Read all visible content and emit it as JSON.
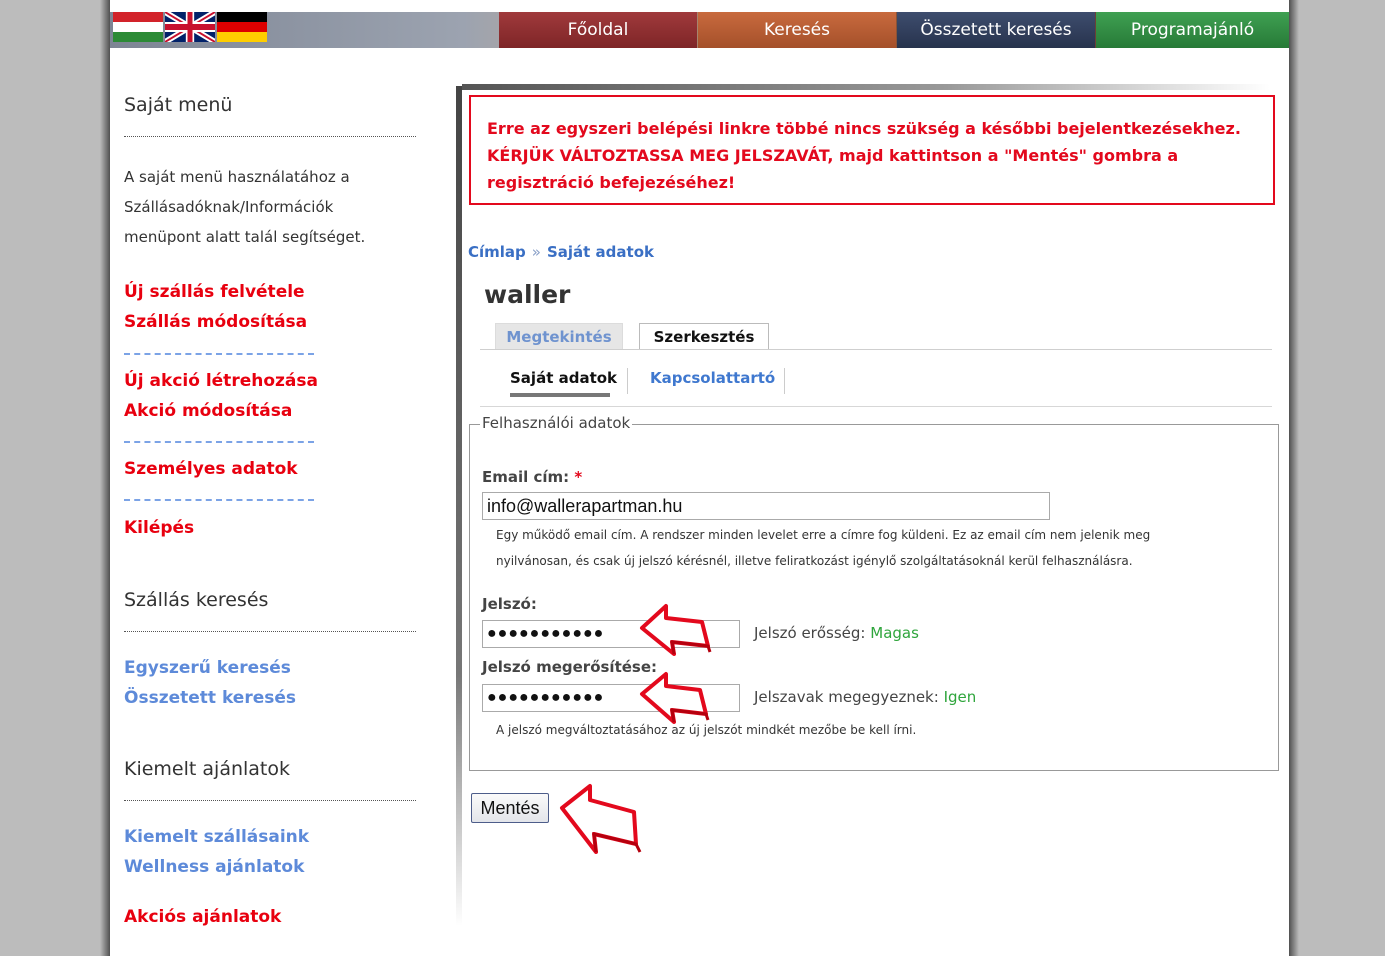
{
  "colors": {
    "accent_red": "#e3091d",
    "link_blue": "#3f78cf",
    "ok_green": "#2fa53c"
  },
  "header": {
    "flags": [
      "hungarian-flag-icon",
      "uk-flag-icon",
      "german-flag-icon"
    ],
    "nav": [
      "Főoldal",
      "Keresés",
      "Összetett keresés",
      "Programajánló"
    ]
  },
  "sidebar": {
    "sajat_menu_title": "Saját menü",
    "info_lines": [
      "A saját menü használatához a",
      "Szállásadóknak/Információk",
      "menüpont alatt talál segítséget."
    ],
    "links_a": [
      "Új szállás felvétele",
      "Szállás módosítása"
    ],
    "links_b": [
      "Új akció létrehozása",
      "Akció módosítása"
    ],
    "link_personal": "Személyes adatok",
    "link_logout": "Kilépés",
    "search_title": "Szállás keresés",
    "search_links": [
      "Egyszerű keresés",
      "Összetett keresés"
    ],
    "featured_title": "Kiemelt ajánlatok",
    "featured_links": [
      "Kiemelt szállásaink",
      "Wellness ajánlatok"
    ],
    "sale_link": "Akciós ajánlatok"
  },
  "main": {
    "alert": {
      "line1": "Erre az egyszeri belépési linkre többé nincs szükség a későbbi bejelentkezésekhez.",
      "line2": "KÉRJÜK VÁLTOZTASSA MEG JELSZAVÁT, majd kattintson a \"Mentés\" gombra a",
      "line3": "regisztráció befejezéséhez!"
    },
    "breadcrumb": {
      "home": "Címlap",
      "separator": "»",
      "current": "Saját adatok"
    },
    "title": "waller",
    "tabs": [
      "Megtekintés",
      "Szerkesztés"
    ],
    "subtabs": [
      "Saját adatok",
      "Kapcsolattartó"
    ],
    "fieldset_legend": "Felhasználói adatok",
    "email": {
      "label": "Email cím:",
      "required_mark": "*",
      "value": "info@wallerapartman.hu",
      "desc1": "Egy működő email cím. A rendszer minden levelet erre a címre fog küldeni. Ez az email cím nem jelenik meg",
      "desc2": "nyilvánosan, és csak új jelszó kérésnél, illetve feliratkozást igénylő szolgáltatásoknál kerül felhasználásra."
    },
    "password": {
      "label": "Jelszó:",
      "value": "●●●●●●●●●●●",
      "strength_label": "Jelszó erősség:",
      "strength_value": "Magas"
    },
    "password_confirm": {
      "label": "Jelszó megerősítése:",
      "value": "●●●●●●●●●●●",
      "match_label": "Jelszavak megegyeznek:",
      "match_value": "Igen",
      "hint": "A jelszó megváltoztatásához az új jelszót mindkét mezőbe be kell írni."
    },
    "save_label": "Mentés",
    "annotation_arrows": [
      "red-arrow-icon",
      "red-arrow-icon",
      "red-arrow-icon"
    ]
  }
}
